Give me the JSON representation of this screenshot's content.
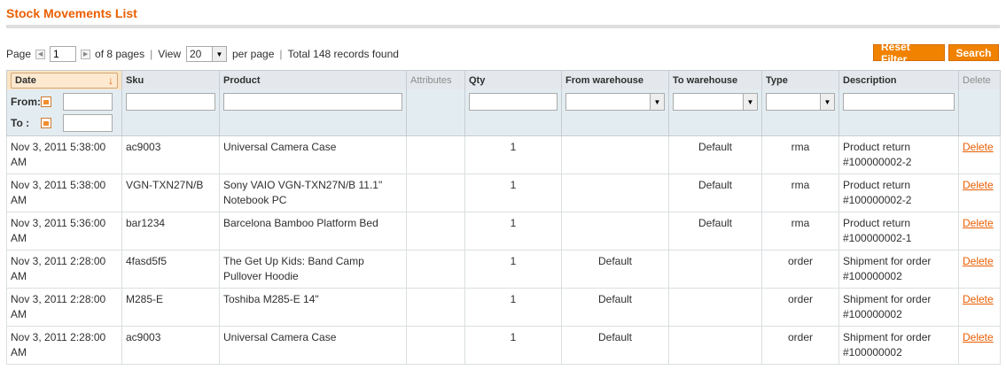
{
  "header": {
    "title": "Stock Movements List"
  },
  "pager": {
    "page_label": "Page",
    "page_value": "1",
    "of_pages": "of 8 pages",
    "view_label": "View",
    "per_page_value": "20",
    "per_page_label": "per page",
    "total": "Total 148 records found"
  },
  "actions": {
    "reset": "Reset Filter",
    "search": "Search"
  },
  "columns": [
    "Date",
    "Sku",
    "Product",
    "Attributes",
    "Qty",
    "From warehouse",
    "To warehouse",
    "Type",
    "Description",
    "Delete"
  ],
  "filters": {
    "from_label": "From:",
    "to_label": "To :"
  },
  "rows": [
    {
      "date": "Nov 3, 2011 5:38:00 AM",
      "sku": "ac9003",
      "product": "Universal Camera Case",
      "attributes": "",
      "qty": "1",
      "from": "",
      "to": "Default",
      "type": "rma",
      "description": "Product return #100000002-2",
      "delete": "Delete"
    },
    {
      "date": "Nov 3, 2011 5:38:00 AM",
      "sku": "VGN-TXN27N/B",
      "product": "Sony VAIO VGN-TXN27N/B 11.1\" Notebook PC",
      "attributes": "",
      "qty": "1",
      "from": "",
      "to": "Default",
      "type": "rma",
      "description": "Product return #100000002-2",
      "delete": "Delete"
    },
    {
      "date": "Nov 3, 2011 5:36:00 AM",
      "sku": "bar1234",
      "product": "Barcelona Bamboo Platform Bed",
      "attributes": "",
      "qty": "1",
      "from": "",
      "to": "Default",
      "type": "rma",
      "description": "Product return #100000002-1",
      "delete": "Delete"
    },
    {
      "date": "Nov 3, 2011 2:28:00 AM",
      "sku": "4fasd5f5",
      "product": "The Get Up Kids: Band Camp Pullover Hoodie",
      "attributes": "",
      "qty": "1",
      "from": "Default",
      "to": "",
      "type": "order",
      "description": "Shipment for order #100000002",
      "delete": "Delete"
    },
    {
      "date": "Nov 3, 2011 2:28:00 AM",
      "sku": "M285-E",
      "product": "Toshiba M285-E 14\"",
      "attributes": "",
      "qty": "1",
      "from": "Default",
      "to": "",
      "type": "order",
      "description": "Shipment for order #100000002",
      "delete": "Delete"
    },
    {
      "date": "Nov 3, 2011 2:28:00 AM",
      "sku": "ac9003",
      "product": "Universal Camera Case",
      "attributes": "",
      "qty": "1",
      "from": "Default",
      "to": "",
      "type": "order",
      "description": "Shipment for order #100000002",
      "delete": "Delete"
    }
  ]
}
